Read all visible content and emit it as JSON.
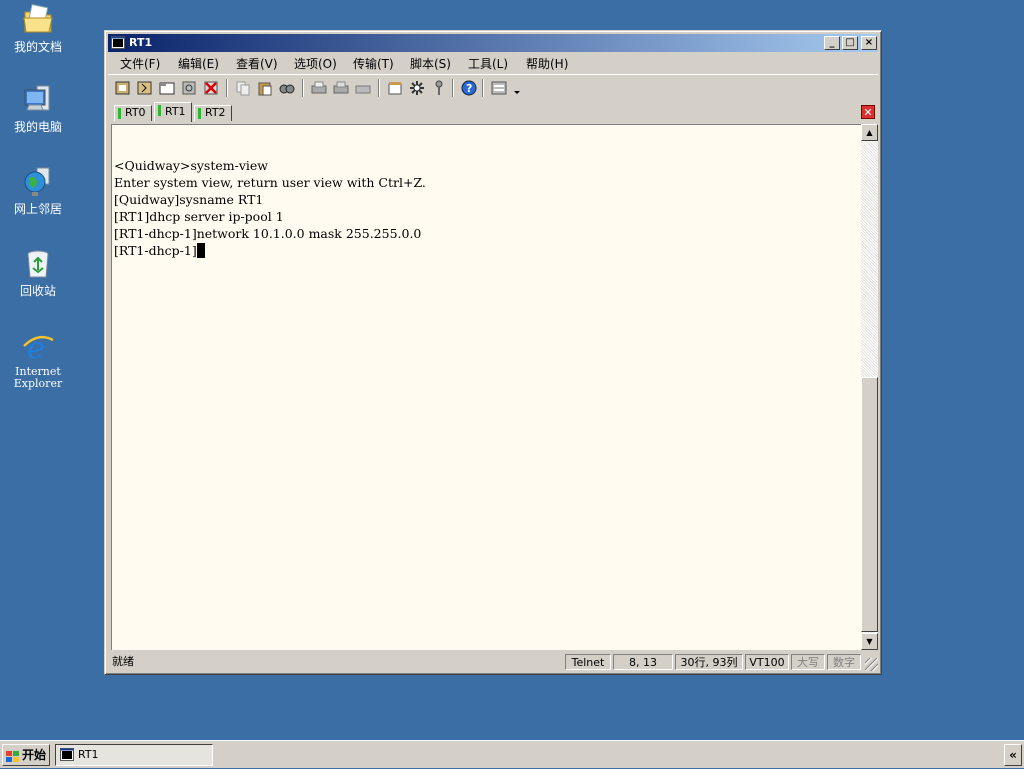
{
  "desktop": {
    "icons": [
      {
        "label": "我的文档"
      },
      {
        "label": "我的电脑"
      },
      {
        "label": "网上邻居"
      },
      {
        "label": "回收站"
      },
      {
        "label": "Internet Explorer"
      }
    ]
  },
  "window": {
    "title": "RT1",
    "controls": {
      "minimize": "_",
      "maximize": "□",
      "close": "×"
    },
    "menu": [
      "文件(F)",
      "编辑(E)",
      "查看(V)",
      "选项(O)",
      "传输(T)",
      "脚本(S)",
      "工具(L)",
      "帮助(H)"
    ],
    "tabs": [
      {
        "label": "RT0",
        "status_color": "#2db82d"
      },
      {
        "label": "RT1",
        "status_color": "#2db82d",
        "active": true
      },
      {
        "label": "RT2",
        "status_color": "#2db82d"
      }
    ],
    "terminal_lines": [
      "",
      "<Quidway>system-view",
      "Enter system view, return user view with Ctrl+Z.",
      "[Quidway]sysname RT1",
      "[RT1]dhcp server ip-pool 1",
      "[RT1-dhcp-1]network 10.1.0.0 mask 255.255.0.0",
      "[RT1-dhcp-1]"
    ],
    "statusbar": {
      "ready": "就绪",
      "protocol": "Telnet",
      "cursor_pos": "8,  13",
      "size": "30行, 93列",
      "emulation": "VT100",
      "caps": "大写",
      "num": "数字"
    }
  },
  "taskbar": {
    "start_label": "开始",
    "task_label": "RT1",
    "tray_label": "«"
  },
  "colors": {
    "desktop": "#3a6ea5",
    "titlebar_start": "#0a246a",
    "titlebar_end": "#a6caf0",
    "terminal_bg": "#fffbf0",
    "tab_close": "#d93030"
  }
}
